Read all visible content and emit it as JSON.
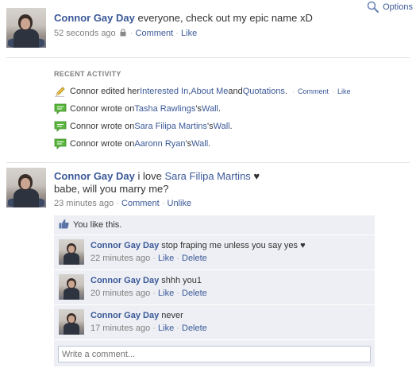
{
  "header": {
    "options_label": "Options"
  },
  "story1": {
    "author": "Connor Gay Day",
    "text": " everyone, check out my epic name xD",
    "time": "52 seconds ago",
    "comment_link": "Comment",
    "like_link": "Like"
  },
  "recent": {
    "title": "RECENT ACTIVITY",
    "item1": {
      "prefix": "Connor edited her ",
      "link1": "Interested In",
      "sep1": ", ",
      "link2": "About Me",
      "sep2": " and ",
      "link3": "Quotations",
      "suffix": ".",
      "comment_link": "Comment",
      "like_link": "Like"
    },
    "item2": {
      "prefix": "Connor wrote on ",
      "person": "Tasha Rawlings",
      "poss": "'s ",
      "wall": "Wall",
      "suffix": "."
    },
    "item3": {
      "prefix": "Connor wrote on ",
      "person": "Sara Filipa Martins",
      "poss": "'s ",
      "wall": "Wall",
      "suffix": "."
    },
    "item4": {
      "prefix": "Connor wrote on ",
      "person": "Aaronn Ryan",
      "poss": "'s ",
      "wall": "Wall",
      "suffix": "."
    }
  },
  "story2": {
    "author": "Connor Gay Day",
    "text_prefix": " i love ",
    "mention": "Sara Filipa Martins",
    "text_suffix": " ♥",
    "line2": "babe, will you marry me?",
    "time": "23 minutes ago",
    "comment_link": "Comment",
    "unlike_link": "Unlike",
    "likes_text": "You like this."
  },
  "comments": [
    {
      "author": "Connor Gay Day",
      "text": " stop fraping me unless you say yes ♥",
      "time": "22 minutes ago",
      "like": "Like",
      "delete": "Delete"
    },
    {
      "author": "Connor Gay Day",
      "text": " shhh you1",
      "time": "20 minutes ago",
      "like": "Like",
      "delete": "Delete"
    },
    {
      "author": "Connor Gay Day",
      "text": " never",
      "time": "17 minutes ago",
      "like": "Like",
      "delete": "Delete"
    }
  ],
  "write_comment": {
    "placeholder": "Write a comment..."
  },
  "icons": {
    "options": "magnifier-icon",
    "lock": "lock-icon",
    "edit": "pencil-icon",
    "wall": "speech-bubble-icon",
    "like": "thumbs-up-icon"
  },
  "colors": {
    "link": "#3b5998",
    "muted": "#808080",
    "feedback_bg": "#edeff4",
    "wall_icon": "#5cb73f"
  }
}
